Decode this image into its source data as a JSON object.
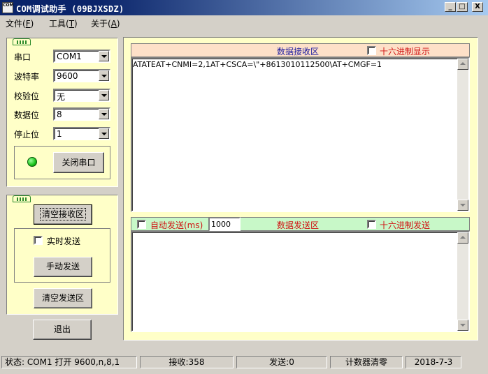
{
  "window": {
    "title": "COM调试助手 (09BJXSDZ)",
    "icon_text": "COM",
    "min_glyph": "_",
    "max_glyph": "□",
    "close_glyph": "X"
  },
  "menu": [
    {
      "label": "文件",
      "accel": "F"
    },
    {
      "label": "工具",
      "accel": "T"
    },
    {
      "label": "关于",
      "accel": "A"
    }
  ],
  "serial_settings": {
    "port_label": "串口",
    "port_value": "COM1",
    "baud_label": "波特率",
    "baud_value": "9600",
    "parity_label": "校验位",
    "parity_value": "无",
    "databits_label": "数据位",
    "databits_value": "8",
    "stopbits_label": "停止位",
    "stopbits_value": "1",
    "close_port_button": "关闭串口",
    "led_color": "#19c219"
  },
  "control": {
    "clear_receive_button": "清空接收区",
    "realtime_send_label": "实时发送",
    "realtime_send_checked": false,
    "manual_send_button": "手动发送",
    "clear_send_button": "清空发送区",
    "exit_button": "退出"
  },
  "receive": {
    "title": "数据接收区",
    "hex_display_label": "十六进制显示",
    "hex_display_checked": false,
    "content": "ATATEAT+CNMI=2,1AT+CSCA=\\\"+8613010112500\\AT+CMGF=1"
  },
  "send": {
    "auto_send_label": "自动发送(ms)",
    "auto_send_checked": false,
    "interval": "1000",
    "title": "数据发送区",
    "hex_send_label": "十六进制发送",
    "hex_send_checked": false,
    "content": ""
  },
  "status": {
    "state": "状态: COM1 打开 9600,n,8,1",
    "received": "接收:358",
    "sent": "发送:0",
    "reset_counter": "计数器清零",
    "date": "2018-7-3"
  },
  "colors": {
    "panel_bg": "#ffffc8",
    "receive_header_bg": "#fde0c8",
    "send_header_bg": "#c8f8c8",
    "title_text_blue": "#1a1aa0",
    "title_text_red": "#d01010"
  }
}
